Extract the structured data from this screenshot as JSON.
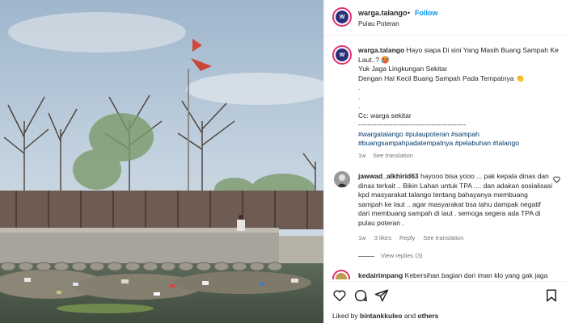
{
  "post": {
    "username": "warga.talango",
    "dot": "•",
    "follow_label": "Follow",
    "location": "Pulau Poteran",
    "avatar_text": "W"
  },
  "caption": {
    "username": "warga.talango",
    "lines": [
      "Hayo siapa Di sini Yang Masih Buang Sampah Ke",
      "Laut..? 🥵",
      "",
      "Yuk Jaga Lingkungan Sekitar",
      "Dengan Hal Kecil Buang Sampah Pada Tempatnya 👏",
      ".",
      ".",
      ".",
      "Cc: warga sekitar",
      "-----------------------------------------------"
    ],
    "first_line": "Hayo siapa Di sini Yang Masih Buang Sampah Ke",
    "second_line": "Laut..? 🥵",
    "line3": "Yuk Jaga Lingkungan Sekitar",
    "line4": "Dengan Hal Kecil Buang Sampah Pada Tempatnya 👏",
    "dot1": ".",
    "dot2": ".",
    "dot3": ".",
    "cc": "Cc: warga sekitar",
    "separator": "-----------------------------------------------",
    "tags_line1": "#wargatalango #pulaupoteran #sampah",
    "tags_line2": "#buangsampahpadatempatnya #pelabuhan #talango",
    "time": "1w",
    "translation": "See translation"
  },
  "comment": {
    "username": "jawwad_alkhirid63",
    "line1": "hayooo bisa yooo ... pak kepala dinas dan",
    "line2": "dinas terkait .. Bikin Lahan untuk TPA .... dan adakan sosialisasi",
    "line3": "kpd masyarakat talango tentang bahayanya membuang",
    "line4": "sampah ke laut .. agar masyarakat bsa tahu dampak negatif",
    "line5": "dari membuang sampah di laut . semoga segera ada TPA di",
    "line6": "pulau poteran .",
    "time": "1w",
    "likes": "3 likes",
    "reply": "Reply",
    "translation": "See translation",
    "view_replies": "View replies (3)"
  },
  "comment2": {
    "username": "kedairimpang",
    "text": "Kebersihan bagian dari iman klo yang gak jaga"
  },
  "likes_bar": {
    "prefix": "Liked by",
    "user": "bintankkuleo",
    "and": "and",
    "others": "others"
  },
  "icons": {
    "like": "heart-icon",
    "comment": "comment-icon",
    "share": "share-icon",
    "save": "bookmark-icon"
  },
  "colors": {
    "follow_blue": "#0095f6",
    "hashtag": "#00376b",
    "muted": "#737373"
  }
}
